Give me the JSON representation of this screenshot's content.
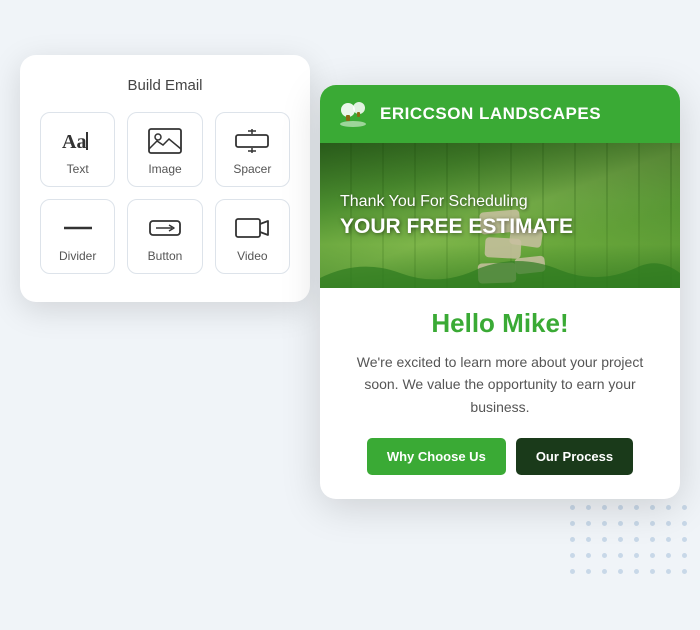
{
  "buildEmail": {
    "title": "Build Email",
    "items": [
      {
        "id": "text",
        "label": "Text",
        "icon": "text-icon"
      },
      {
        "id": "image",
        "label": "Image",
        "icon": "image-icon"
      },
      {
        "id": "spacer",
        "label": "Spacer",
        "icon": "spacer-icon"
      },
      {
        "id": "divider",
        "label": "Divider",
        "icon": "divider-icon"
      },
      {
        "id": "button",
        "label": "Button",
        "icon": "button-icon"
      },
      {
        "id": "video",
        "label": "Video",
        "icon": "video-icon"
      }
    ]
  },
  "emailPreview": {
    "brandName": "ERICCSON LANDSCAPES",
    "heroLine1": "Thank You For Scheduling",
    "heroLine2": "YOUR FREE ESTIMATE",
    "greeting": "Hello Mike!",
    "bodyText": "We're excited to learn more about your project soon. We value the opportunity to earn your business.",
    "button1": "Why Choose Us",
    "button2": "Our Process"
  }
}
